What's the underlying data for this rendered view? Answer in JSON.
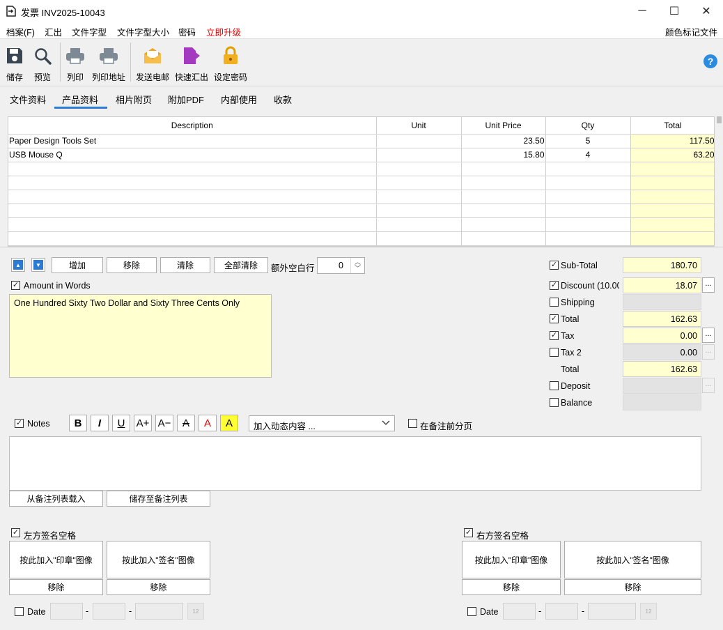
{
  "window": {
    "title": "发票 INV2025-10043",
    "min_glyph": "─",
    "max_glyph": "☐",
    "close_glyph": "✕"
  },
  "menu": {
    "file": "档案(F)",
    "export": "汇出",
    "font": "文件字型",
    "font_size": "文件字型大小",
    "password": "密码",
    "upgrade": "立即升级",
    "color_tag": "颜色标记文件",
    "upgrade_color": "#e00000"
  },
  "toolbar": {
    "save": "储存",
    "preview": "预览",
    "print": "列印",
    "print_address": "列印地址",
    "send_email": "发送电邮",
    "quick_export": "快速汇出",
    "set_password": "设定密码",
    "help_glyph": "?"
  },
  "tabs": [
    "文件资料",
    "产品资料",
    "相片附页",
    "附加PDF",
    "内部使用",
    "收款"
  ],
  "grid": {
    "headers": [
      "Description",
      "Unit",
      "Unit Price",
      "Qty",
      "Total"
    ],
    "rows": [
      [
        "Paper Design Tools Set",
        "",
        "23.50",
        "5",
        "117.50"
      ],
      [
        "USB Mouse Q",
        "",
        "15.80",
        "4",
        "63.20"
      ],
      [
        "",
        "",
        "",
        "",
        ""
      ],
      [
        "",
        "",
        "",
        "",
        ""
      ],
      [
        "",
        "",
        "",
        "",
        ""
      ],
      [
        "",
        "",
        "",
        "",
        ""
      ],
      [
        "",
        "",
        "",
        "",
        ""
      ],
      [
        "",
        "",
        "",
        "",
        ""
      ]
    ]
  },
  "row_actions": {
    "add": "增加",
    "remove": "移除",
    "clear": "清除",
    "clear_all": "全部清除",
    "extra_blank_label": "额外空白行",
    "extra_blank_value": "0",
    "up_glyph": "▲",
    "down_glyph": "▼",
    "spin_up": "︿",
    "spin_down": "﹀"
  },
  "amount_in_words": {
    "label": "Amount in Words",
    "text": "One Hundred Sixty Two Dollar and Sixty Three Cents Only"
  },
  "totals": {
    "subtotal_label": "Sub-Total",
    "subtotal": "180.70",
    "discount_label": "Discount (10.00",
    "discount": "18.07",
    "shipping_label": "Shipping",
    "shipping": "",
    "total_label": "Total",
    "total": "162.63",
    "tax_label": "Tax",
    "tax": "0.00",
    "tax2_label": "Tax 2",
    "tax2": "0.00",
    "grand_total_label": "Total",
    "grand_total": "162.63",
    "deposit_label": "Deposit",
    "deposit": "",
    "balance_label": "Balance",
    "balance": "",
    "dots": "..."
  },
  "notes": {
    "label": "Notes",
    "bold": "B",
    "italic": "I",
    "underline": "U",
    "bigger": "A+",
    "smaller": "A−",
    "strike": "A",
    "color": "A",
    "highlight": "A",
    "dynamic_placeholder": "加入动态内容 ...",
    "page_break_label": "在备注前分页",
    "load": "从备注列表载入",
    "save": "储存至备注列表"
  },
  "left_signature": {
    "label": "左方签名空格",
    "stamp": "按此加入\"印章\"图像",
    "sign": "按此加入\"签名\"图像",
    "remove": "移除",
    "date_label": "Date"
  },
  "right_signature": {
    "label": "右方签名空格",
    "stamp": "按此加入\"印章\"图像",
    "sign": "按此加入\"签名\"图像",
    "remove": "移除",
    "date_label": "Date"
  },
  "check_glyph": "✓",
  "date_dash": "-",
  "calendar_glyph": "12"
}
